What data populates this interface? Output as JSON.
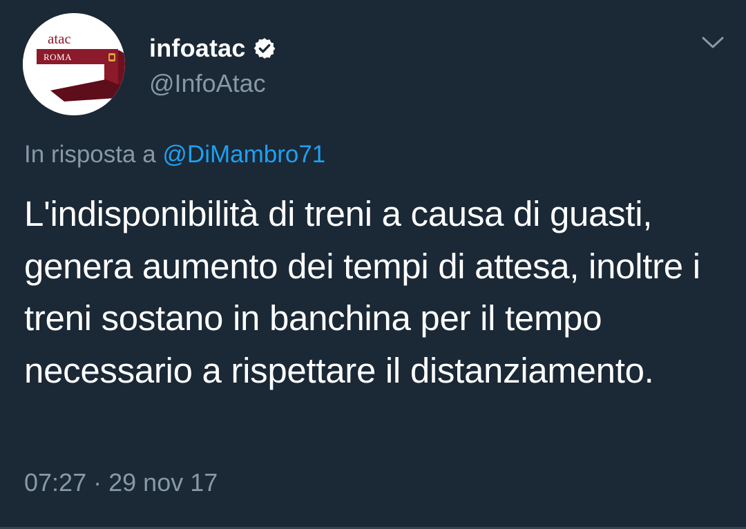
{
  "author": {
    "display_name": "infoatac",
    "handle": "@InfoAtac",
    "verified": true,
    "avatar_logo_text": "atac",
    "avatar_logo_subtext": "ROMA"
  },
  "reply": {
    "prefix": "In risposta a",
    "target": "@DiMambro71"
  },
  "tweet": {
    "text": "L'indisponibilità di treni a causa di guasti, genera aumento dei tempi di attesa, inoltre i treni sostano in banchina per il tempo necessario a rispettare il distanziamento.",
    "time": "07:27",
    "separator": "·",
    "date": "29 nov 17"
  },
  "icons": {
    "verified": "verified-badge-icon",
    "menu": "chevron-down-icon"
  },
  "colors": {
    "background": "#1b2836",
    "secondary_text": "#8899a6",
    "link": "#1da1f2",
    "divider": "#38444d",
    "logo_red": "#8b1a2b"
  }
}
